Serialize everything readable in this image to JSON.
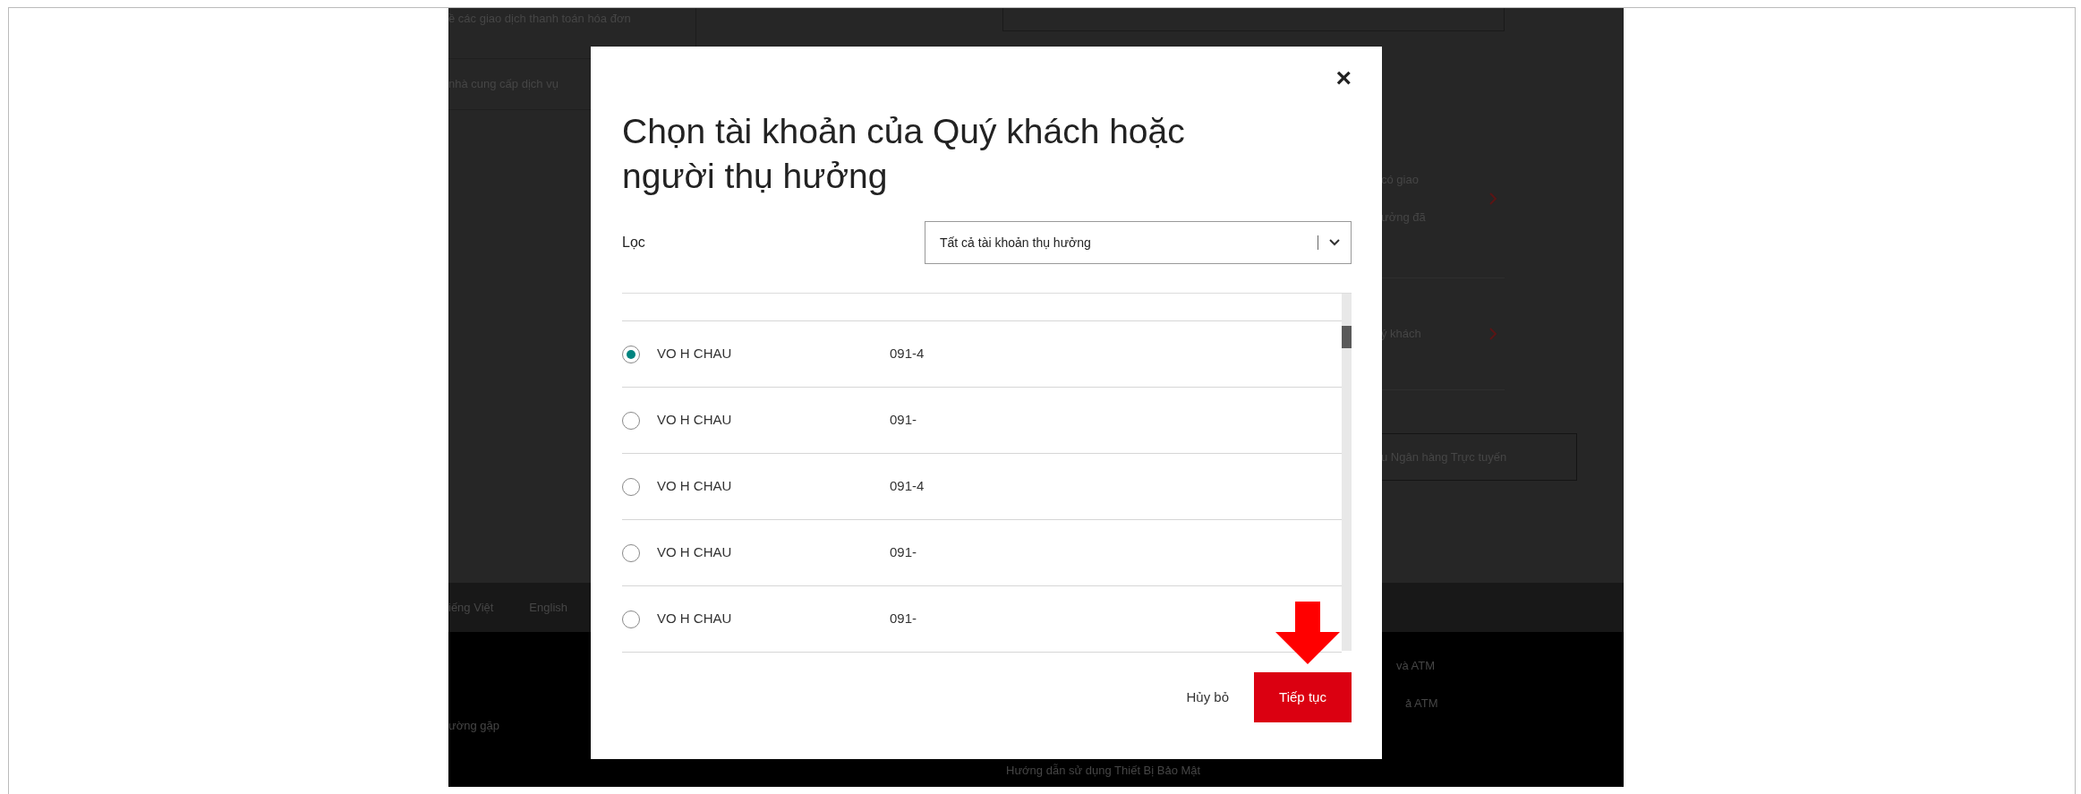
{
  "background_page": {
    "left_menu": [
      "ề các giao dịch thanh toán hóa đơn",
      "nhà cung cấp dịch vụ"
    ],
    "right_items": [
      {
        "lines": [
          "có giao",
          "ưởng đã"
        ]
      },
      {
        "lines": [
          "ý khách"
        ]
      }
    ],
    "right_button": "u Ngân hàng Trực tuyến",
    "language_links": [
      "iếng Việt",
      "English"
    ],
    "footer_links": [
      "ường gặp",
      "Hướng dẫn sử dụng Thiết Bị Bảo Mật",
      "và ATM",
      "ả ATM"
    ]
  },
  "dialog": {
    "close": "×",
    "title": "Chọn tài khoản của Quý khách hoặc người thụ hưởng",
    "filter_label": "Lọc",
    "filter_value": "Tất cả tài khoản thụ hưởng",
    "rows": [
      {
        "name": "VO H CHAU",
        "account": "091-4",
        "selected": true
      },
      {
        "name": "VO H CHAU",
        "account": "091-",
        "selected": false
      },
      {
        "name": "VO H CHAU",
        "account": "091-4",
        "selected": false
      },
      {
        "name": "VO H CHAU",
        "account": "091-",
        "selected": false
      },
      {
        "name": "VO H CHAU",
        "account": "091-",
        "selected": false
      }
    ],
    "cancel": "Hủy bỏ",
    "continue": "Tiếp tục"
  }
}
